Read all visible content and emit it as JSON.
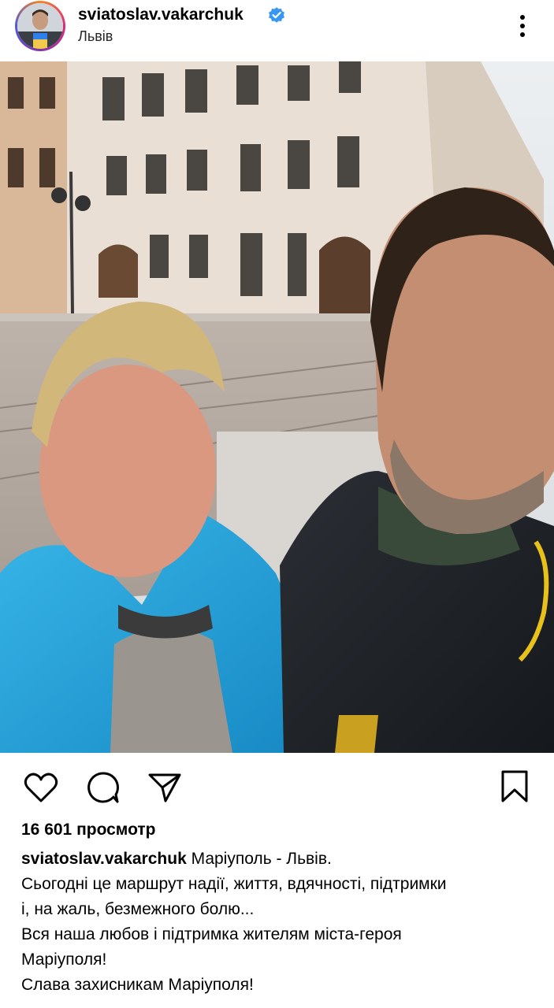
{
  "header": {
    "username": "sviatoslav.vakarchuk",
    "location": "Львів",
    "verified": true,
    "icons": {
      "verified": "verified-badge-icon",
      "more": "more-vertical-icon"
    }
  },
  "media": {
    "type": "video",
    "muted": true,
    "icons": {
      "mute": "speaker-muted-icon"
    }
  },
  "actions": {
    "icons": [
      "heart-icon",
      "comment-icon",
      "share-icon",
      "bookmark-icon"
    ]
  },
  "stats": {
    "views": "16 601 просмотр"
  },
  "caption": {
    "username": "sviatoslav.vakarchuk",
    "first_line": "Маріуполь - Львів.",
    "lines": [
      "Сьогодні це маршрут надії, життя, вдячності, підтримки",
      "і, на жаль, безмежного болю...",
      "Вся наша любов і підтримка жителям міста-героя",
      "Маріуполя!",
      "Слава захисникам Маріуполя!"
    ]
  },
  "colors": {
    "verified_blue": "#3897f0",
    "text": "#000000",
    "background": "#ffffff"
  }
}
